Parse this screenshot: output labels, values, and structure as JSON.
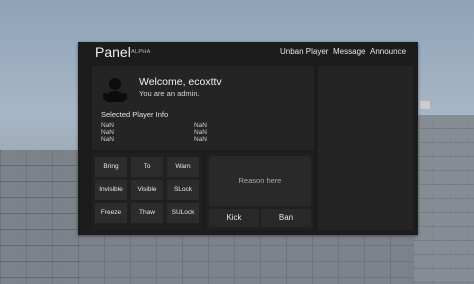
{
  "panel": {
    "title": "Panel",
    "badge": "ALPHA",
    "nav": [
      "Unban Player",
      "Message",
      "Announce"
    ]
  },
  "user": {
    "welcome": "Welcome, ecoxttv",
    "role_text": "You are an admin."
  },
  "player_info": {
    "title": "Selected Player Info",
    "left": [
      "NaN",
      "NaN",
      "NaN"
    ],
    "right": [
      "NaN",
      "NaN",
      "NaN"
    ]
  },
  "commands": [
    [
      "Bring",
      "To",
      "Warn"
    ],
    [
      "Invisible",
      "Visible",
      "SLock"
    ],
    [
      "Freeze",
      "Thaw",
      "SULock"
    ]
  ],
  "reason": {
    "placeholder": "Reason here"
  },
  "actions": {
    "kick": "Kick",
    "ban": "Ban"
  }
}
